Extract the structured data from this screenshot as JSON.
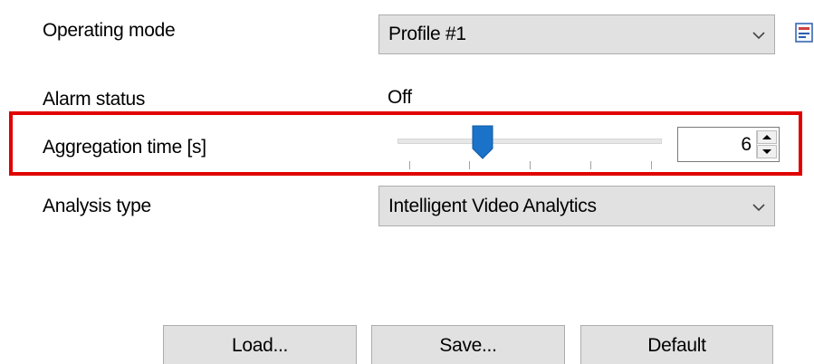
{
  "rows": {
    "operating_mode": {
      "label": "Operating mode",
      "value": "Profile #1"
    },
    "alarm_status": {
      "label": "Alarm status",
      "value": "Off"
    },
    "aggregation_time": {
      "label": "Aggregation time [s]",
      "value": "6",
      "slider_level": 0.3
    },
    "analysis_type": {
      "label": "Analysis type",
      "value": "Intelligent Video Analytics"
    }
  },
  "buttons": {
    "load": "Load...",
    "save": "Save...",
    "default": "Default"
  },
  "icons": {
    "operating_mode_chevron": "chevron-down-icon",
    "analysis_type_chevron": "chevron-down-icon",
    "profile_edit": "edit-profile-icon",
    "spin_up": "triangle-up-icon",
    "spin_down": "triangle-down-icon"
  },
  "colors": {
    "highlight": "#e00000",
    "slider_thumb": "#1a73c8"
  }
}
